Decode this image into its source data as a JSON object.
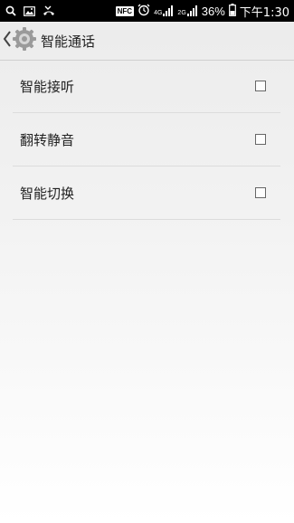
{
  "status_bar": {
    "nfc_label": "NFC",
    "net1_label": "4G",
    "net2_label": "2G",
    "battery_percent": "36%",
    "time": "下午1:30",
    "icons": [
      "search-icon",
      "image-icon",
      "missed-call-icon",
      "nfc-icon",
      "alarm-icon",
      "signal-icon",
      "battery-icon"
    ]
  },
  "header": {
    "title": "智能通话",
    "icons": [
      "back-icon",
      "settings-gear-icon"
    ]
  },
  "settings": [
    {
      "label": "智能接听",
      "checked": false
    },
    {
      "label": "翻转静音",
      "checked": false
    },
    {
      "label": "智能切换",
      "checked": false
    }
  ]
}
